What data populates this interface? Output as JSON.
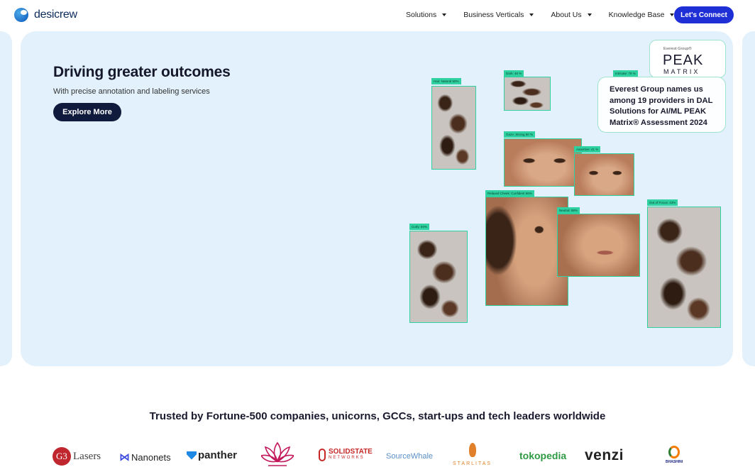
{
  "header": {
    "logo_text": "desicrew",
    "nav": [
      {
        "label": "Solutions"
      },
      {
        "label": "Business Verticals"
      },
      {
        "label": "About Us"
      },
      {
        "label": "Knowledge Base"
      }
    ],
    "cta_label": "Let's Connect"
  },
  "hero": {
    "title": "Driving greater outcomes",
    "subtitle": "With precise annotation and labeling services",
    "button_label": "Explore More",
    "tags": {
      "hair_natural": "Hair: Natural 60%",
      "dark": "Dark: 46 %",
      "intricate": "Intricate: 79 %",
      "gaze": "Gaze: Strong 60 %",
      "assertive": "Assertive: 41 %",
      "relaxed": "Relaxed Cheek: Confident 66%",
      "neutral": "Neutral: 88%",
      "curly": "Curly: 94%",
      "out_of_focus": "Out of Focus: 43%"
    }
  },
  "peak_badge": {
    "small": "Everest Group®",
    "big": "PEAK",
    "matrix": "MATRIX",
    "text": "Everest Group names us among 19 providers in DAL Solutions for AI/ML PEAK Matrix® Assessment 2024"
  },
  "trusted": {
    "heading": "Trusted by Fortune-500 companies, unicorns, GCCs, start-ups and tech leaders worldwide",
    "logos": {
      "g3": "G3",
      "g3_word": "Lasers",
      "nanonets": "Nanonets",
      "panther": "panther",
      "solidstate": "SOLIDSTATE",
      "solidstate_sub": "NETWORKS",
      "sourcewhale": "SourceWhale",
      "starlitas": "STARLITAS",
      "tokopedia": "tokopedia",
      "venzi": "venzi",
      "bhashini": "BHASHINI"
    }
  },
  "colors": {
    "accent": "#1f2fd6",
    "hero_bg": "#e2f1fb",
    "tag_green": "#2fd1a0",
    "dark_button": "#0f1a3d"
  }
}
